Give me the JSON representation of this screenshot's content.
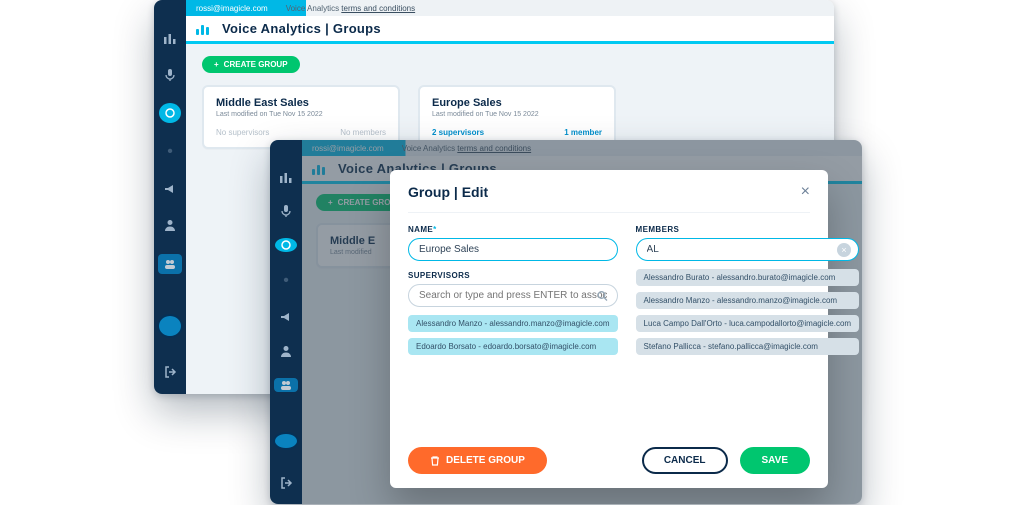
{
  "sysbar": {
    "email": "rossi@imagicle.com",
    "terms_prefix": "Voice Analytics ",
    "terms_link": "terms and conditions"
  },
  "title": {
    "app": "Voice Analytics",
    "sep": "  |  ",
    "section": "Groups"
  },
  "toolbar": {
    "create_group": "CREATE GROUP"
  },
  "back_cards": [
    {
      "name": "Middle East Sales",
      "modified": "Last modified on Tue Nov 15 2022",
      "supervisors": "No supervisors",
      "members": "No members",
      "sup_style": "muted",
      "mem_style": "muted"
    },
    {
      "name": "Europe Sales",
      "modified": "Last modified on Tue Nov 15 2022",
      "supervisors": "2 supervisors",
      "members": "1 member",
      "sup_style": "link",
      "mem_style": "link"
    }
  ],
  "front_cards": [
    {
      "name": "Middle E",
      "modified": "Last modified",
      "supervisors": "",
      "members": ""
    }
  ],
  "modal": {
    "title": "Group | Edit",
    "labels": {
      "name": "NAME",
      "supervisors": "SUPERVISORS",
      "members": "MEMBERS"
    },
    "name_value": "Europe Sales",
    "supervisor_search_placeholder": "Search or type and press ENTER to associate…",
    "members_filter_value": "AL",
    "supervisor_chips": [
      "Alessandro Manzo - alessandro.manzo@imagicle.com",
      "Edoardo Borsato - edoardo.borsato@imagicle.com"
    ],
    "member_chips": [
      "Alessandro Burato - alessandro.burato@imagicle.com",
      "Alessandro Manzo - alessandro.manzo@imagicle.com",
      "Luca Campo Dall'Orto - luca.campodallorto@imagicle.com",
      "Stefano Pallicca - stefano.pallicca@imagicle.com"
    ],
    "buttons": {
      "delete": "DELETE GROUP",
      "cancel": "CANCEL",
      "save": "SAVE"
    }
  }
}
